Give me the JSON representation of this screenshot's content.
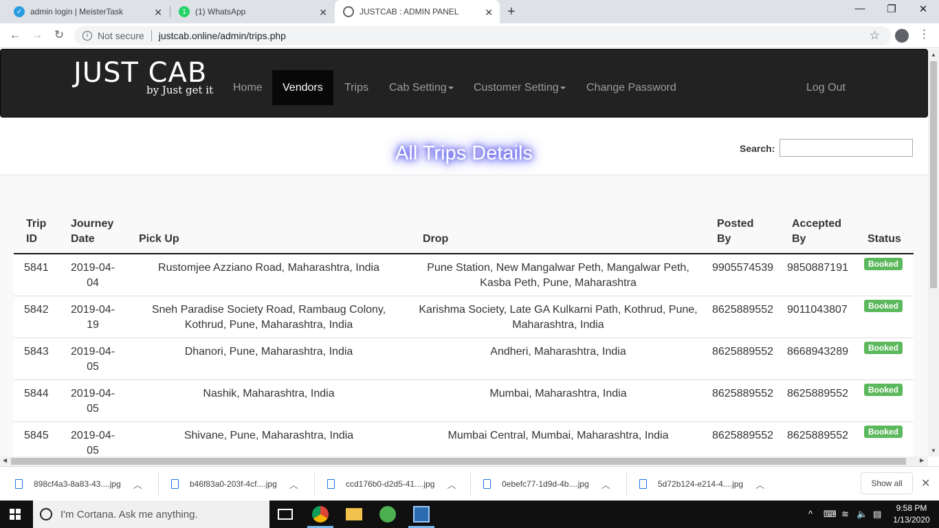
{
  "browser": {
    "tabs": [
      {
        "title": "admin login | MeisterTask",
        "color": "#2a9de0"
      },
      {
        "title": "(1) WhatsApp",
        "color": "#25d366",
        "badge": "1"
      },
      {
        "title": "JUSTCAB : ADMIN PANEL",
        "color": "#5f6368"
      }
    ],
    "security_label": "Not secure",
    "url": "justcab.online/admin/trips.php"
  },
  "navbar": {
    "brand_name": "JUST CAB",
    "brand_tagline": "by Just get it",
    "items": [
      {
        "label": "Home"
      },
      {
        "label": "Vendors"
      },
      {
        "label": "Trips"
      },
      {
        "label": "Cab Setting"
      },
      {
        "label": "Customer Setting"
      },
      {
        "label": "Change Password"
      }
    ],
    "logout_label": "Log Out"
  },
  "page": {
    "title": "All Trips Details",
    "search_label": "Search:",
    "search_value": ""
  },
  "table": {
    "headers": {
      "trip_id": [
        "Trip",
        "ID"
      ],
      "journey_date": [
        "Journey",
        "Date"
      ],
      "pick_up": "Pick Up",
      "drop": "Drop",
      "posted_by": [
        "Posted",
        "By"
      ],
      "accepted_by": [
        "Accepted",
        "By"
      ],
      "status": "Status"
    },
    "rows": [
      {
        "id": "5841",
        "date": [
          "2019-04-",
          "04"
        ],
        "pickup": [
          "Rustomjee Azziano Road, Maharashtra, India"
        ],
        "drop": [
          "Pune Station, New Mangalwar Peth, Mangalwar Peth,",
          "Kasba Peth, Pune, Maharashtra"
        ],
        "posted": "9905574539",
        "accepted": "9850887191",
        "status": "Booked"
      },
      {
        "id": "5842",
        "date": [
          "2019-04-",
          "19"
        ],
        "pickup": [
          "Sneh Paradise Society Road, Rambaug Colony,",
          "Kothrud, Pune, Maharashtra, India"
        ],
        "drop": [
          "Karishma Society, Late GA Kulkarni Path, Kothrud, Pune,",
          "Maharashtra, India"
        ],
        "posted": "8625889552",
        "accepted": "9011043807",
        "status": "Booked"
      },
      {
        "id": "5843",
        "date": [
          "2019-04-",
          "05"
        ],
        "pickup": [
          "Dhanori, Pune, Maharashtra, India"
        ],
        "drop": [
          "Andheri, Maharashtra, India"
        ],
        "posted": "8625889552",
        "accepted": "8668943289",
        "status": "Booked"
      },
      {
        "id": "5844",
        "date": [
          "2019-04-",
          "05"
        ],
        "pickup": [
          "Nashik, Maharashtra, India"
        ],
        "drop": [
          "Mumbai, Maharashtra, India"
        ],
        "posted": "8625889552",
        "accepted": "8625889552",
        "status": "Booked"
      },
      {
        "id": "5845",
        "date": [
          "2019-04-",
          "05"
        ],
        "pickup": [
          "Shivane, Pune, Maharashtra, India"
        ],
        "drop": [
          "Mumbai Central, Mumbai, Maharashtra, India"
        ],
        "posted": "8625889552",
        "accepted": "8625889552",
        "status": "Booked"
      }
    ]
  },
  "downloads": {
    "items": [
      {
        "name": "898cf4a3-8a83-43....jpg"
      },
      {
        "name": "b46f83a0-203f-4cf....jpg"
      },
      {
        "name": "ccd176b0-d2d5-41....jpg"
      },
      {
        "name": "0ebefc77-1d9d-4b....jpg"
      },
      {
        "name": "5d72b124-e214-4....jpg"
      }
    ],
    "show_all_label": "Show all"
  },
  "taskbar": {
    "cortana_placeholder": "I'm Cortana. Ask me anything.",
    "time": "9:58 PM",
    "date": "1/13/2020"
  }
}
